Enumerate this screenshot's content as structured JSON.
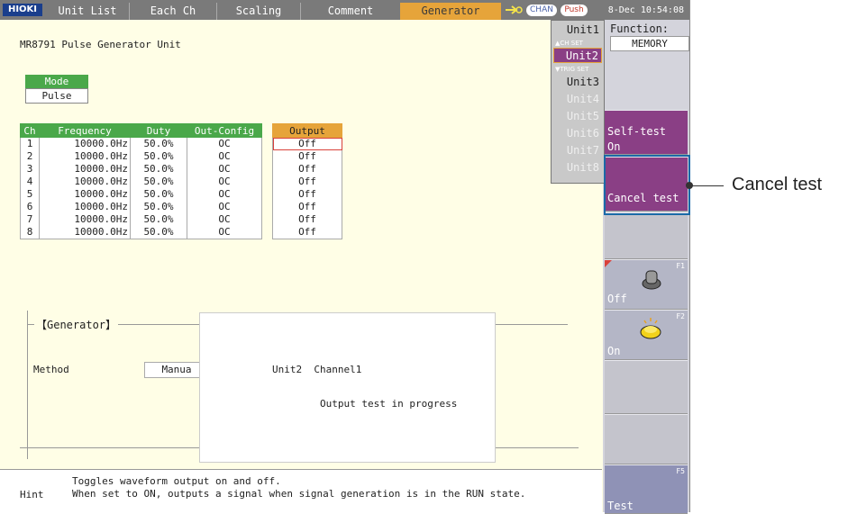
{
  "tabs": {
    "logo": "HIOKI",
    "items": [
      "Unit List",
      "Each Ch",
      "Scaling",
      "Comment",
      "Generator"
    ],
    "active": "Generator",
    "chan_pill": "CHAN",
    "push_pill": "Push",
    "clock": "8-Dec 10:54:08"
  },
  "main": {
    "title": "MR8791 Pulse Generator Unit",
    "mode_label": "Mode",
    "mode_value": "Pulse",
    "columns": [
      "Ch",
      "Frequency",
      "Duty",
      "Out-Config"
    ],
    "output_header": "Output",
    "rows": [
      {
        "ch": "1",
        "freq": "10000.0Hz",
        "duty": "50.0%",
        "cfg": "OC",
        "out": "Off"
      },
      {
        "ch": "2",
        "freq": "10000.0Hz",
        "duty": "50.0%",
        "cfg": "OC",
        "out": "Off"
      },
      {
        "ch": "3",
        "freq": "10000.0Hz",
        "duty": "50.0%",
        "cfg": "OC",
        "out": "Off"
      },
      {
        "ch": "4",
        "freq": "10000.0Hz",
        "duty": "50.0%",
        "cfg": "OC",
        "out": "Off"
      },
      {
        "ch": "5",
        "freq": "10000.0Hz",
        "duty": "50.0%",
        "cfg": "OC",
        "out": "Off"
      },
      {
        "ch": "6",
        "freq": "10000.0Hz",
        "duty": "50.0%",
        "cfg": "OC",
        "out": "Off"
      },
      {
        "ch": "7",
        "freq": "10000.0Hz",
        "duty": "50.0%",
        "cfg": "OC",
        "out": "Off"
      },
      {
        "ch": "8",
        "freq": "10000.0Hz",
        "duty": "50.0%",
        "cfg": "OC",
        "out": "Off"
      }
    ],
    "generator_section": "【Generator】",
    "method_label": "Method",
    "method_value": "Manua"
  },
  "dialog": {
    "line1": "Unit2  Channel1",
    "line2": "Output test in progress"
  },
  "hint": {
    "label": "Hint",
    "line1": "Toggles waveform output on and off.",
    "line2": "When set to ON, outputs a signal when signal generation is in the RUN state."
  },
  "units": {
    "items": [
      "Unit1",
      "Unit2",
      "Unit3",
      "Unit4",
      "Unit5",
      "Unit6",
      "Unit7",
      "Unit8"
    ],
    "selected": "Unit2",
    "chset": "▲CH SET",
    "trigset": "▼TRIG SET"
  },
  "right_panel": {
    "function_label": "Function:",
    "function_value": "MEMORY",
    "selftest_label": "Self-test",
    "selftest_value": "On",
    "cancel_test": "Cancel test",
    "f1_key": "F1",
    "f1_label": "Off",
    "f2_key": "F2",
    "f2_label": "On",
    "f5_key": "F5",
    "f5_label": "Test"
  },
  "callout": "Cancel test",
  "colors": {
    "header_green": "#4aa84a",
    "active_orange": "#e6a43a",
    "purple": "#8a3f85",
    "screen_bg": "#fffee6"
  }
}
